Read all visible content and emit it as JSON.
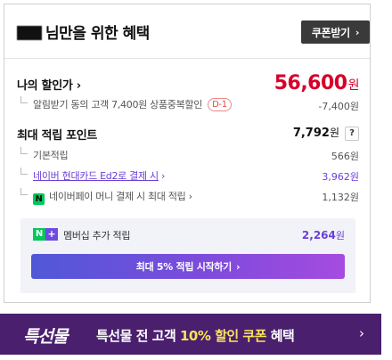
{
  "header": {
    "title_suffix": "님만을 위한 혜택",
    "coupon_button": "쿠폰받기"
  },
  "discount": {
    "label": "나의 할인가",
    "price": "56,600",
    "unit": "원",
    "alarm_label": "알림받기 동의 고객 7,400원 상품중복할인",
    "dday": "D-1",
    "alarm_amount": "-7,400원"
  },
  "points": {
    "label": "최대 적립 포인트",
    "total": "7,792",
    "unit": "원",
    "help": "?",
    "items": [
      {
        "label": "기본적립",
        "amount": "566원"
      },
      {
        "label": "네이버 현대카드 Ed2로 결제 시",
        "amount": "3,962원"
      },
      {
        "label": "네이버페이 머니 결제 시 최대 적립",
        "amount": "1,132원"
      }
    ]
  },
  "membership": {
    "badge_n": "N",
    "badge_plus": "+",
    "label": "멤버십 추가 적립",
    "amount": "2,264",
    "unit": "원",
    "cta": "최대 5% 적립 시작하기"
  },
  "banner": {
    "logo": "특선물",
    "text_prefix": "특선물 전 고객 ",
    "text_highlight": "10% 할인 쿠폰",
    "text_suffix": " 혜택"
  },
  "colors": {
    "price_red": "#d6002a",
    "accent_purple": "#6a3fd6",
    "banner_bg": "#4a1f6e",
    "naver_green": "#03c75a"
  }
}
